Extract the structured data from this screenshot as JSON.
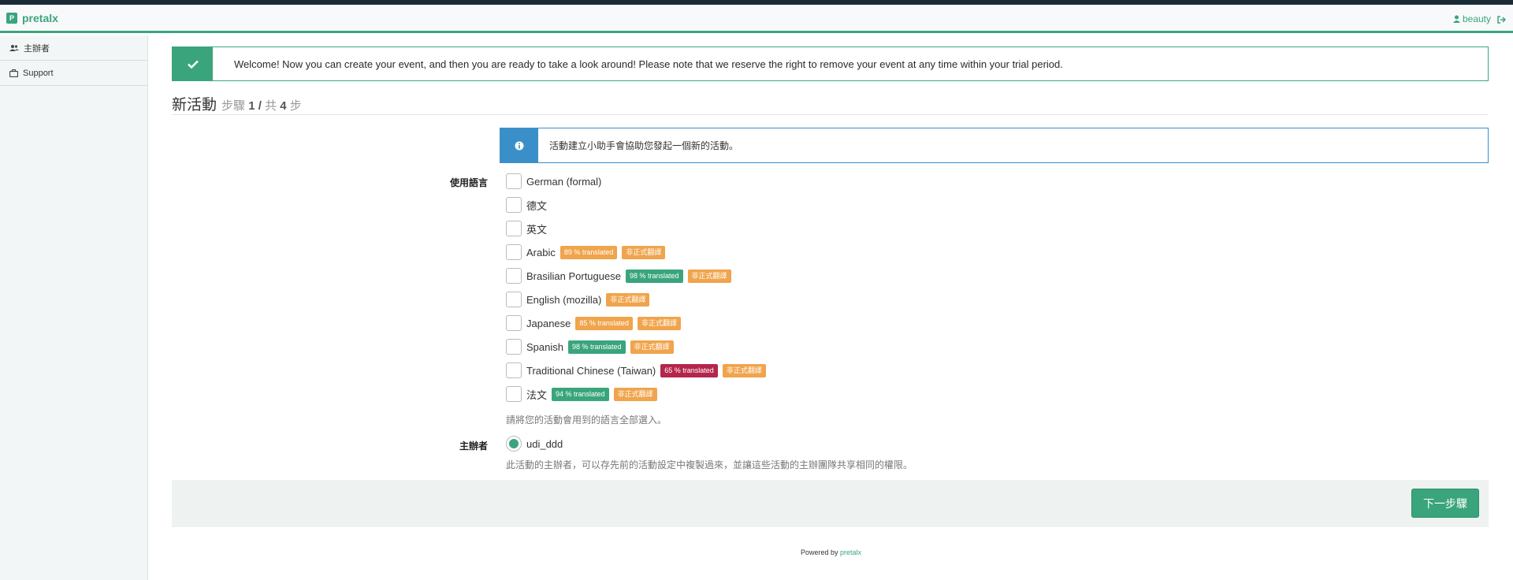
{
  "navbar": {
    "brand_logo": "P",
    "brand_name": "pretalx",
    "user": "beauty",
    "logout_icon": "sign-out-icon",
    "user_icon": "user-icon"
  },
  "sidebar": {
    "items": [
      {
        "label": "主辦者",
        "icon": "users-icon"
      },
      {
        "label": "Support",
        "icon": "briefcase-icon"
      }
    ]
  },
  "welcome": {
    "icon": "check-icon",
    "text": "Welcome! Now you can create your event, and then you are ready to take a look around! Please note that we reserve the right to remove your event at any time within your trial period."
  },
  "heading": {
    "title": "新活動",
    "step_word": "步驟",
    "step_current": "1",
    "step_sep": "/",
    "total_word": "共",
    "step_total": "4",
    "step_suffix": "步"
  },
  "info": {
    "icon": "info-icon",
    "text": "活動建立小助手會協助您發起一個新的活動。"
  },
  "languages": {
    "label": "使用語言",
    "help": "請將您的活動會用到的語言全部選入。",
    "options": [
      {
        "name": "German (formal)",
        "badges": []
      },
      {
        "name": "德文",
        "badges": []
      },
      {
        "name": "英文",
        "badges": []
      },
      {
        "name": "Arabic",
        "badges": [
          {
            "text": "89 % translated",
            "color": "#f0a44c"
          },
          {
            "text": "非正式翻譯",
            "color": "#f0a44c"
          }
        ]
      },
      {
        "name": "Brasilian Portuguese",
        "badges": [
          {
            "text": "98 % translated",
            "color": "#3aa57c"
          },
          {
            "text": "非正式翻譯",
            "color": "#f0a44c"
          }
        ]
      },
      {
        "name": "English (mozilla)",
        "badges": [
          {
            "text": "非正式翻譯",
            "color": "#f0a44c"
          }
        ]
      },
      {
        "name": "Japanese",
        "badges": [
          {
            "text": "85 % translated",
            "color": "#f0a44c"
          },
          {
            "text": "非正式翻譯",
            "color": "#f0a44c"
          }
        ]
      },
      {
        "name": "Spanish",
        "badges": [
          {
            "text": "98 % translated",
            "color": "#3aa57c"
          },
          {
            "text": "非正式翻譯",
            "color": "#f0a44c"
          }
        ]
      },
      {
        "name": "Traditional Chinese (Taiwan)",
        "badges": [
          {
            "text": "65 % translated",
            "color": "#b5264c"
          },
          {
            "text": "非正式翻譯",
            "color": "#f0a44c"
          }
        ]
      },
      {
        "name": "法文",
        "badges": [
          {
            "text": "94 % translated",
            "color": "#3aa57c"
          },
          {
            "text": "非正式翻譯",
            "color": "#f0a44c"
          }
        ]
      }
    ]
  },
  "organiser": {
    "label": "主辦者",
    "option": "udi_ddd",
    "selected": true,
    "help": "此活動的主辦者，可以存先前的活動設定中複製過來，並讓這些活動的主辦團隊共享相同的權限。"
  },
  "next_button": "下一步驟",
  "footer": {
    "powered_by": "Powered by",
    "link": "pretalx"
  },
  "colors": {
    "primary": "#3aa57c",
    "info": "#3b8fc8",
    "warning": "#f0a44c",
    "danger": "#b5264c"
  }
}
